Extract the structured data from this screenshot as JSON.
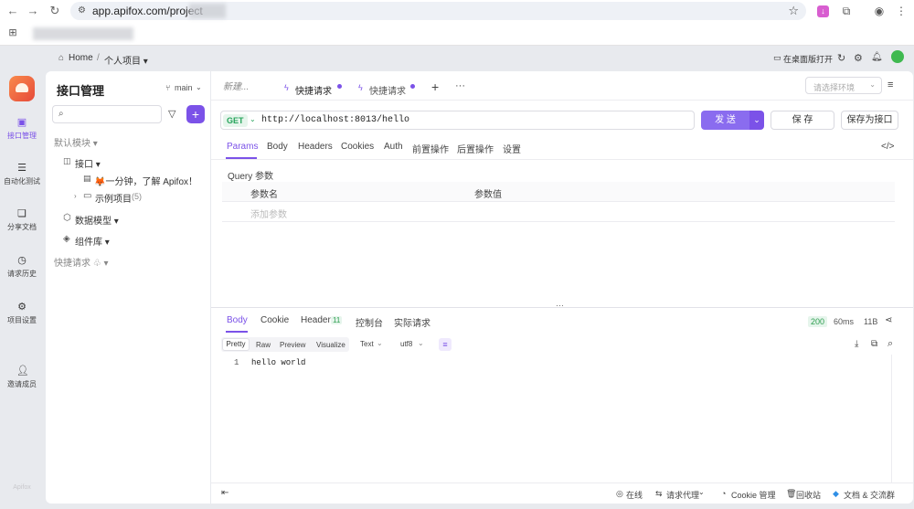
{
  "browser": {
    "url": "app.apifox.com/project",
    "nav": {
      "back": "←",
      "forward": "→",
      "reload": "↻"
    }
  },
  "topbar": {
    "breadcrumb_home": "Home",
    "breadcrumb_sep": "/",
    "breadcrumb_project": "个人项目 ▾",
    "open_desktop": "在桌面版打开"
  },
  "rail": [
    {
      "label": "接口管理",
      "icon": "api-icon"
    },
    {
      "label": "自动化测试",
      "icon": "auto-test-icon"
    },
    {
      "label": "分享文档",
      "icon": "share-doc-icon"
    },
    {
      "label": "请求历史",
      "icon": "history-icon"
    },
    {
      "label": "项目设置",
      "icon": "settings-icon"
    },
    {
      "label": "邀请成员",
      "icon": "invite-icon"
    }
  ],
  "rail_footer": "Apifox",
  "sidebar": {
    "title": "接口管理",
    "branch": "main",
    "default_module": "默认模块 ▾",
    "api_folder": "接口 ▾",
    "intro_item": "🦊一分钟，了解 Apifox！",
    "example_project": "示例项目",
    "example_count": "(5)",
    "data_model": "数据模型 ▾",
    "components": "组件库 ▾",
    "quick_requests": "快捷请求 ♧ ▾"
  },
  "tabs": {
    "new": "新建...",
    "quick1": "快捷请求",
    "quick2": "快捷请求",
    "add": "+",
    "more": "···",
    "env_placeholder": "请选择环境"
  },
  "request": {
    "method": "GET",
    "url": "http://localhost:8013/hello",
    "send": "发 送",
    "save": "保 存",
    "save_as": "保存为接口"
  },
  "req_tabs": [
    "Params",
    "Body",
    "Headers",
    "Cookies",
    "Auth",
    "前置操作",
    "后置操作",
    "设置"
  ],
  "params": {
    "section": "Query 参数",
    "col_name": "参数名",
    "col_value": "参数值",
    "add_placeholder": "添加参数"
  },
  "response": {
    "tabs": [
      "Body",
      "Cookie",
      "Header",
      "控制台",
      "实际请求"
    ],
    "header_count": "11",
    "status": "200",
    "time": "60ms",
    "size": "11B",
    "view_modes": [
      "Pretty",
      "Raw",
      "Preview",
      "Visualize"
    ],
    "format": "Text",
    "encoding": "utf8",
    "line_no": "1",
    "body": "hello world"
  },
  "footer": {
    "online": "在线",
    "proxy": "请求代理",
    "cookie": "Cookie 管理",
    "trash": "回收站",
    "docs": "文档 & 交流群"
  },
  "colors": {
    "accent": "#7b52e8",
    "get_green": "#25a35a",
    "status_green": "#2e9e4f"
  }
}
